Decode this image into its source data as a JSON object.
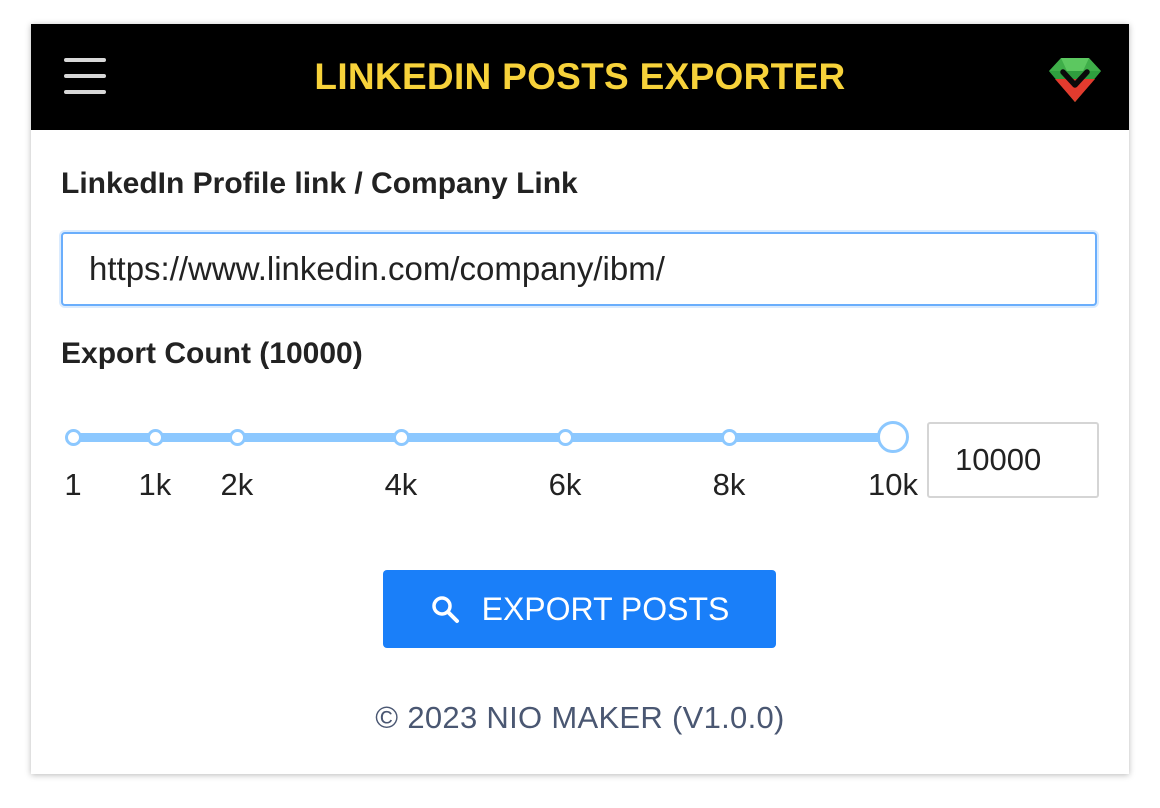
{
  "header": {
    "title": "LINKEDIN POSTS EXPORTER",
    "title_color": "#f7d23a",
    "background_color": "#000000",
    "menu_icon": "hamburger-menu-icon",
    "logo_icon": "gem-logo-icon"
  },
  "profile_field": {
    "label": "LinkedIn Profile link / Company Link",
    "value": "https://www.linkedin.com/company/ibm/"
  },
  "export_count": {
    "label": "Export Count (10000)",
    "value": "10000",
    "slider": {
      "min": 1,
      "max": 10000,
      "current": 10000,
      "marks": [
        {
          "value": 1,
          "label": "1"
        },
        {
          "value": 1000,
          "label": "1k"
        },
        {
          "value": 2000,
          "label": "2k"
        },
        {
          "value": 4000,
          "label": "4k"
        },
        {
          "value": 6000,
          "label": "6k"
        },
        {
          "value": 8000,
          "label": "8k"
        },
        {
          "value": 10000,
          "label": "10k"
        }
      ],
      "track_color": "#8cc8ff"
    }
  },
  "export_button": {
    "label": "EXPORT POSTS",
    "icon": "search-icon",
    "color": "#1a7ff9"
  },
  "footer": {
    "text": "© 2023 NIO MAKER (V1.0.0)"
  }
}
